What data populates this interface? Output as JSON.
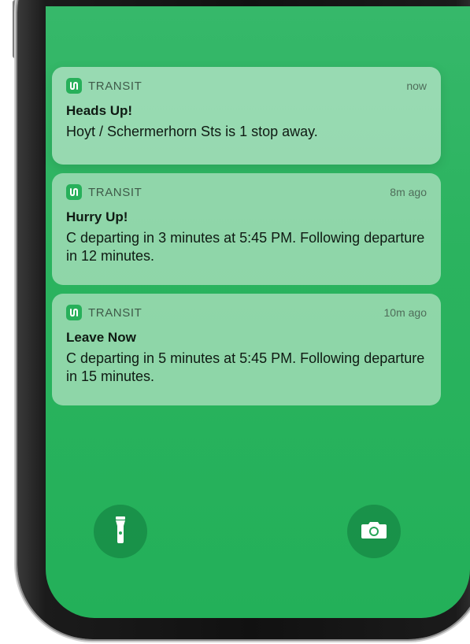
{
  "notifications": [
    {
      "app": "TRANSIT",
      "time": "now",
      "title": "Heads Up!",
      "body": "Hoyt / Schermerhorn Sts is 1 stop away."
    },
    {
      "app": "TRANSIT",
      "time": "8m ago",
      "title": "Hurry Up!",
      "body": "C departing in 3 minutes at 5:45 PM. Following departure in 12 minutes."
    },
    {
      "app": "TRANSIT",
      "time": "10m ago",
      "title": "Leave Now",
      "body": "C departing in 5 minutes at 5:45 PM. Following departure in 15 minutes."
    }
  ],
  "lockscreen": {
    "left_button_icon": "flashlight-icon",
    "right_button_icon": "camera-icon"
  },
  "colors": {
    "screen_green": "#2bb35f",
    "app_icon_green": "#27b05a"
  }
}
